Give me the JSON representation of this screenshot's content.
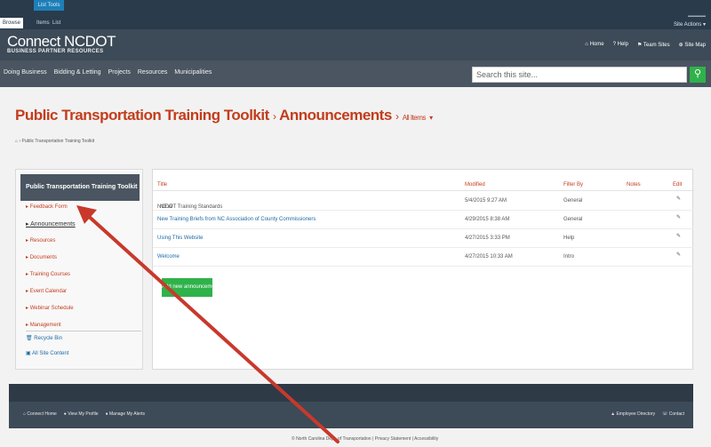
{
  "ribbon": {
    "context_tab": "List Tools",
    "tabs": [
      {
        "label": "Browse",
        "selected": true
      },
      {
        "label": "Items",
        "selected": false
      },
      {
        "label": "List",
        "selected": false
      }
    ],
    "site_actions": "Site Actions",
    "site_actions_icon": "chevron-down-icon"
  },
  "brand": {
    "name": "Connect NCDOT",
    "subtitle": "BUSINESS PARTNER RESOURCES"
  },
  "top_links": [
    {
      "label": "Home",
      "icon": "home-icon"
    },
    {
      "label": "Help",
      "icon": "help-icon"
    },
    {
      "label": "Team Sites",
      "icon": "flag-icon"
    },
    {
      "label": "Site Map",
      "icon": "sitemap-icon"
    }
  ],
  "top_nav": [
    "Doing Business",
    "Bidding & Letting",
    "Projects",
    "Resources",
    "Municipalities"
  ],
  "search": {
    "placeholder": "Search this site..."
  },
  "page": {
    "site": "Public Transportation Training Toolkit",
    "separator": "›",
    "list": "Announcements",
    "view": "All Items"
  },
  "breadcrumb": [
    "Public Transportation Training Toolkit"
  ],
  "left_nav": {
    "heading": "Public Transportation Training Toolkit",
    "items": [
      {
        "label": "Feedback Form",
        "active": false
      },
      {
        "label": "Announcements",
        "active": true
      },
      {
        "label": "Resources",
        "active": false
      },
      {
        "label": "Documents",
        "active": false
      },
      {
        "label": "Training Courses",
        "active": false
      },
      {
        "label": "Event Calendar",
        "active": false
      },
      {
        "label": "Webinar Schedule",
        "active": false
      },
      {
        "label": "Management",
        "active": false
      }
    ],
    "tools": [
      {
        "label": "Recycle Bin",
        "icon": "recycle-bin-icon"
      },
      {
        "label": "All Site Content",
        "icon": "site-content-icon"
      }
    ]
  },
  "grid": {
    "columns": [
      "Title",
      "Modified",
      "Filter By",
      "Notes",
      "Edit"
    ],
    "rows": [
      {
        "title": "NCDOT Training Standards",
        "new": "NEW",
        "modified": "5/4/2015 9:27 AM",
        "filter": "General"
      },
      {
        "title": "New Training Briefs from NC Association of County Commissioners",
        "new": "",
        "modified": "4/29/2015 8:38 AM",
        "filter": "General"
      },
      {
        "title": "Using This Website",
        "new": "",
        "modified": "4/27/2015 3:33 PM",
        "filter": "Help"
      },
      {
        "title": "Welcome",
        "new": "",
        "modified": "4/27/2015 10:33 AM",
        "filter": "Intro"
      }
    ],
    "add_button": "Add new announcement"
  },
  "footer": {
    "left_links": [
      "Connect Home",
      "View My Profile",
      "Manage My Alerts"
    ],
    "right_links": [
      "Employee Directory",
      "Contact"
    ],
    "copyright": "© North Carolina Dept. of Transportation | Privacy Statement | Accessibility"
  },
  "colors": {
    "accent": "#c33d1c",
    "link": "#1e6aa5",
    "button": "#2fb24a",
    "arrow": "#c8392b"
  }
}
